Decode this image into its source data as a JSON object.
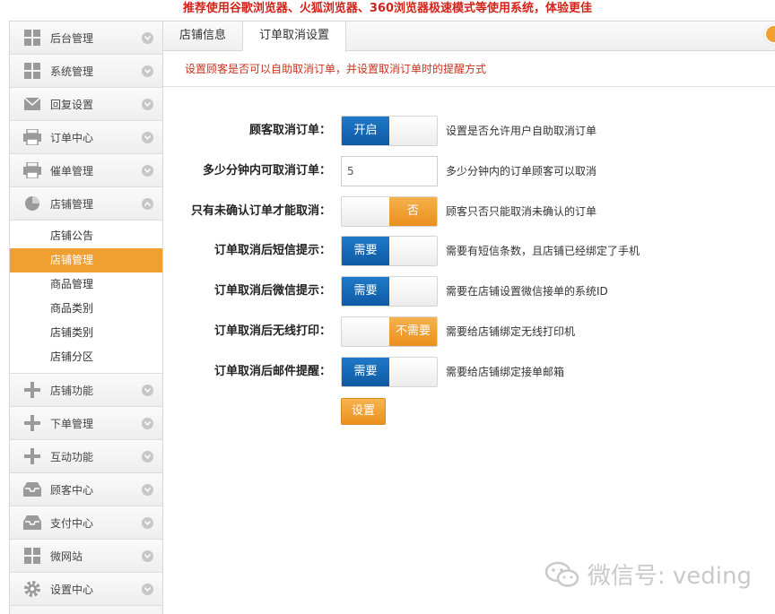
{
  "banner": "推荐使用谷歌浏览器、火狐浏览器、360浏览器极速模式等使用系统，体验更佳",
  "sidebar": {
    "items": [
      {
        "label": "后台管理",
        "icon": "grid-icon"
      },
      {
        "label": "系统管理",
        "icon": "grid-icon"
      },
      {
        "label": "回复设置",
        "icon": "mail-icon"
      },
      {
        "label": "订单中心",
        "icon": "printer-icon"
      },
      {
        "label": "催单管理",
        "icon": "printer-icon"
      },
      {
        "label": "店铺管理",
        "icon": "pie-icon",
        "expanded": true
      }
    ],
    "submenu": [
      {
        "label": "店铺公告"
      },
      {
        "label": "店铺管理",
        "active": true
      },
      {
        "label": "商品管理"
      },
      {
        "label": "商品类别"
      },
      {
        "label": "店铺类别"
      },
      {
        "label": "店铺分区"
      }
    ],
    "items_after": [
      {
        "label": "店铺功能",
        "icon": "plus-icon"
      },
      {
        "label": "下单管理",
        "icon": "plus-icon"
      },
      {
        "label": "互动功能",
        "icon": "plus-icon"
      },
      {
        "label": "顾客中心",
        "icon": "inbox-icon"
      },
      {
        "label": "支付中心",
        "icon": "inbox-icon"
      },
      {
        "label": "微网站",
        "icon": "grid-icon"
      },
      {
        "label": "设置中心",
        "icon": "gear-icon"
      }
    ]
  },
  "tabs": [
    {
      "label": "店铺信息",
      "active": false
    },
    {
      "label": "订单取消设置",
      "active": true
    }
  ],
  "notice": "设置顾客是否可以自助取消订单，并设置取消订单时的提醒方式",
  "form": {
    "rows": [
      {
        "label": "顾客取消订单：",
        "type": "switch",
        "state": "on",
        "on_text": "开启",
        "off_text": "",
        "hint": "设置是否允许用户自助取消订单"
      },
      {
        "label": "多少分钟内可取消订单：",
        "type": "input",
        "value": "5",
        "hint": "多少分钟内的订单顾客可以取消"
      },
      {
        "label": "只有未确认订单才能取消：",
        "type": "switch",
        "state": "off",
        "on_text": "",
        "off_text": "否",
        "hint": "顾客只否只能取消未确认的订单"
      },
      {
        "label": "订单取消后短信提示：",
        "type": "switch",
        "state": "on",
        "on_text": "需要",
        "off_text": "",
        "hint": "需要有短信条数，且店铺已经绑定了手机"
      },
      {
        "label": "订单取消后微信提示：",
        "type": "switch",
        "state": "on",
        "on_text": "需要",
        "off_text": "",
        "hint": "需要在店铺设置微信接单的系统ID"
      },
      {
        "label": "订单取消后无线打印：",
        "type": "switch",
        "state": "off",
        "on_text": "",
        "off_text": "不需要",
        "hint": "需要给店铺绑定无线打印机"
      },
      {
        "label": "订单取消后邮件提醒：",
        "type": "switch",
        "state": "on",
        "on_text": "需要",
        "off_text": "",
        "hint": "需要给店铺绑定接单邮箱"
      }
    ],
    "submit_label": "设置"
  },
  "watermark": {
    "text": "微信号: veding",
    "icon": "wechat-icon"
  },
  "colors": {
    "accent_orange": "#f0a030",
    "blue": "#1565b5",
    "notice_red": "#c8341f"
  }
}
